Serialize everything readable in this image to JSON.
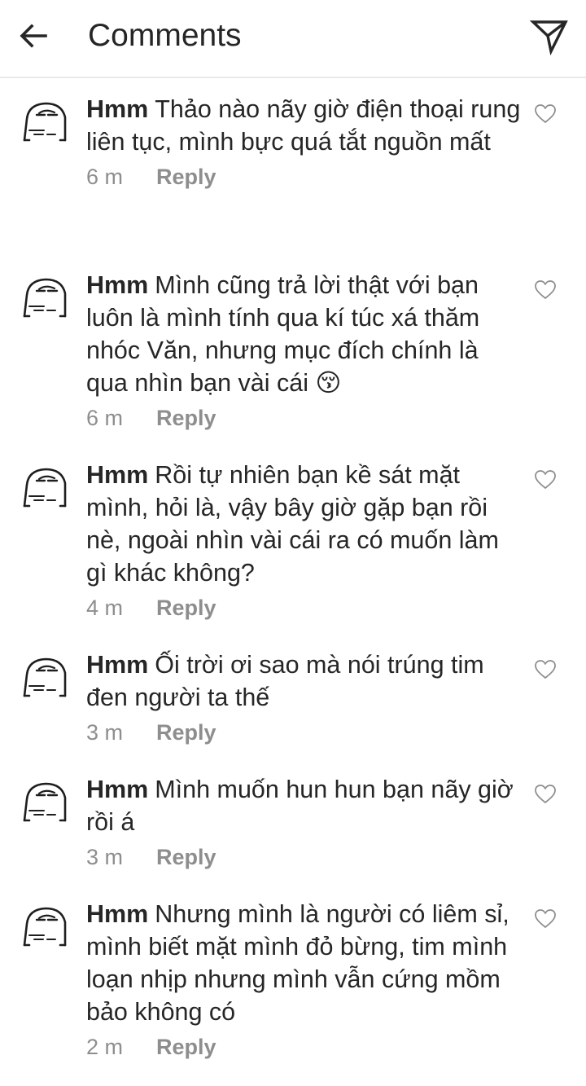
{
  "header": {
    "title": "Comments",
    "back_icon": "arrow-left-icon",
    "send_icon": "paper-plane-icon"
  },
  "colors": {
    "text": "#262626",
    "secondary": "#8e8e8e",
    "divider": "#e9e9e9",
    "background": "#ffffff"
  },
  "comments": [
    {
      "author": "Hmm",
      "text": "Thảo nào nãy giờ điện thoại rung liên tục, mình bực quá tắt nguồn mất",
      "time": "6 m",
      "reply": "Reply"
    },
    {
      "author": "Hmm",
      "text": "Mình cũng trả lời thật với bạn luôn là mình tính qua kí túc xá thăm nhóc Văn, nhưng mục đích chính là qua nhìn bạn vài cái 😚",
      "time": "6 m",
      "reply": "Reply"
    },
    {
      "author": "Hmm",
      "text": "Rồi tự nhiên bạn kề sát mặt mình, hỏi là, vậy bây giờ gặp bạn rồi nè, ngoài nhìn vài cái ra có muốn làm gì khác không?",
      "time": "4 m",
      "reply": "Reply"
    },
    {
      "author": "Hmm",
      "text": "Ối trời ơi sao mà nói trúng tim đen người ta thế",
      "time": "3 m",
      "reply": "Reply"
    },
    {
      "author": "Hmm",
      "text": "Mình muốn hun hun bạn nãy giờ rồi á",
      "time": "3 m",
      "reply": "Reply"
    },
    {
      "author": "Hmm",
      "text": "Nhưng mình là người có liêm sỉ, mình biết mặt mình đỏ bừng, tim mình loạn nhịp nhưng mình vẫn cứng mồm bảo không có",
      "time": "2 m",
      "reply": "Reply"
    }
  ]
}
